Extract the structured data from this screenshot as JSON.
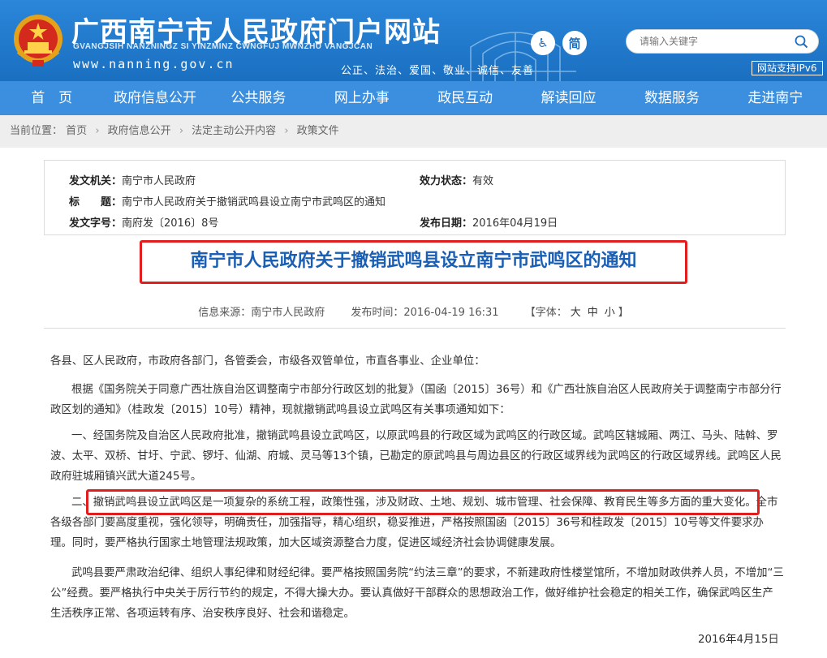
{
  "header": {
    "title": "广西南宁市人民政府门户网站",
    "pinyin": "GVANGJSIH NANZNINGZ SI YINZMINZ CWNGFUJ MWNZHU VANGJCAN",
    "url": "www.nanning.gov.cn",
    "slogan": "公正、法治、爱国、敬业、诚信、友善",
    "accessibility_label": "♿",
    "simplified_label": "简",
    "search_placeholder": "请输入关键字",
    "ipv6_label": "网站支持IPv6"
  },
  "nav": [
    "首　页",
    "政府信息公开",
    "公共服务",
    "网上办事",
    "政民互动",
    "解读回应",
    "数据服务",
    "走进南宁"
  ],
  "breadcrumb": {
    "prefix": "当前位置：",
    "items": [
      "首页",
      "政府信息公开",
      "法定主动公开内容",
      "政策文件"
    ],
    "sep": "›"
  },
  "meta": {
    "issuer_label": "发文机关：",
    "issuer": "南宁市人民政府",
    "status_label": "效力状态：",
    "status": "有效",
    "title_label": "标　　题：",
    "title": "南宁市人民政府关于撤销武鸣县设立南宁市武鸣区的通知",
    "doc_no_label": "发文字号：",
    "doc_no": "南府发〔2016〕8号",
    "date_label": "发布日期：",
    "date": "2016年04月19日"
  },
  "document": {
    "title": "南宁市人民政府关于撤销武鸣县设立南宁市武鸣区的通知",
    "source": "信息来源：南宁市人民政府",
    "publish_time": "发布时间：2016-04-19 16:31",
    "font_label": "【字体：",
    "font_large": "大",
    "font_medium": "中",
    "font_small": "小",
    "font_end": "】",
    "paragraphs": [
      "各县、区人民政府，市政府各部门，各管委会，市级各双管单位，市直各事业、企业单位：",
      "根据《国务院关于同意广西壮族自治区调整南宁市部分行政区划的批复》（国函〔2015〕36号）和《广西壮族自治区人民政府关于调整南宁市部分行政区划的通知》（桂政发〔2015〕10号）精神，现就撤销武鸣县设立武鸣区有关事项通知如下：",
      "一、经国务院及自治区人民政府批准，撤销武鸣县设立武鸣区，以原武鸣县的行政区域为武鸣区的行政区域。武鸣区辖城厢、两江、马头、陆斡、罗波、太平、双桥、甘圩、宁武、锣圩、仙湖、府城、灵马等13个镇，已勘定的原武鸣县与周边县区的行政区域界线为武鸣区的行政区域界线。武鸣区人民政府驻城厢镇兴武大道245号。",
      "二、撤销武鸣县设立武鸣区是一项复杂的系统工程，政策性强，涉及财政、土地、规划、城市管理、社会保障、教育民生等多方面的重大变化。全市各级各部门要高度重视，强化领导，明确责任，加强指导，精心组织，稳妥推进，严格按照国函〔2015〕36号和桂政发〔2015〕10号等文件要求办理。同时，要严格执行国家土地管理法规政策，加大区域资源整合力度，促进区域经济社会协调健康发展。",
      "武鸣县要严肃政治纪律、组织人事纪律和财经纪律。要严格按照国务院“约法三章”的要求，不新建政府性楼堂馆所，不增加财政供养人员，不增加“三公”经费。要严格执行中央关于厉行节约的规定，不得大操大办。要认真做好干部群众的思想政治工作，做好维护社会稳定的相关工作，确保武鸣区生产生活秩序正常、各项运转有序、治安秩序良好、社会和谐稳定。"
    ],
    "date": "2016年4月15日"
  },
  "colors": {
    "header_bg": "#1a6fc0",
    "nav_bg": "#3c8fde",
    "title_blue": "#1a5fb3",
    "highlight_red": "#e21d1d"
  }
}
